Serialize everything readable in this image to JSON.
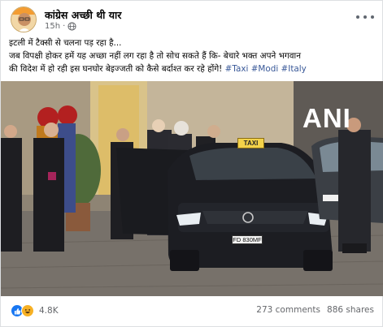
{
  "post": {
    "page_name": "कांग्रेस अच्छी थी यार",
    "time": "15h",
    "visibility_icon": "globe-icon",
    "text_line1": "इटली में टैक्सी से चलना पड़ रहा है...",
    "text_line2": " जब विपक्षी होकर हमें यह अच्छा नहीं लग रहा है तो सोच सकते हैं कि- बेचारे भक्त अपने भगवान",
    "text_line3": "की विदेश में हो रही इस घनघोर बेइज्जती को कैसे बर्दाश्त कर रहे होंगे!",
    "hashtags": [
      "#Taxi",
      "#Modi",
      "#Italy"
    ]
  },
  "media": {
    "watermark": "ANI",
    "taxi_sign": "TAXI",
    "plate": "FD 830MF"
  },
  "footer": {
    "reaction_icons": [
      "like-icon",
      "haha-icon"
    ],
    "reaction_count": "4.8K",
    "comments": "273 comments",
    "shares": "886 shares"
  },
  "colors": {
    "link": "#385898",
    "like": "#1877f2",
    "haha": "#f7b125",
    "secondary_text": "#65676b"
  }
}
